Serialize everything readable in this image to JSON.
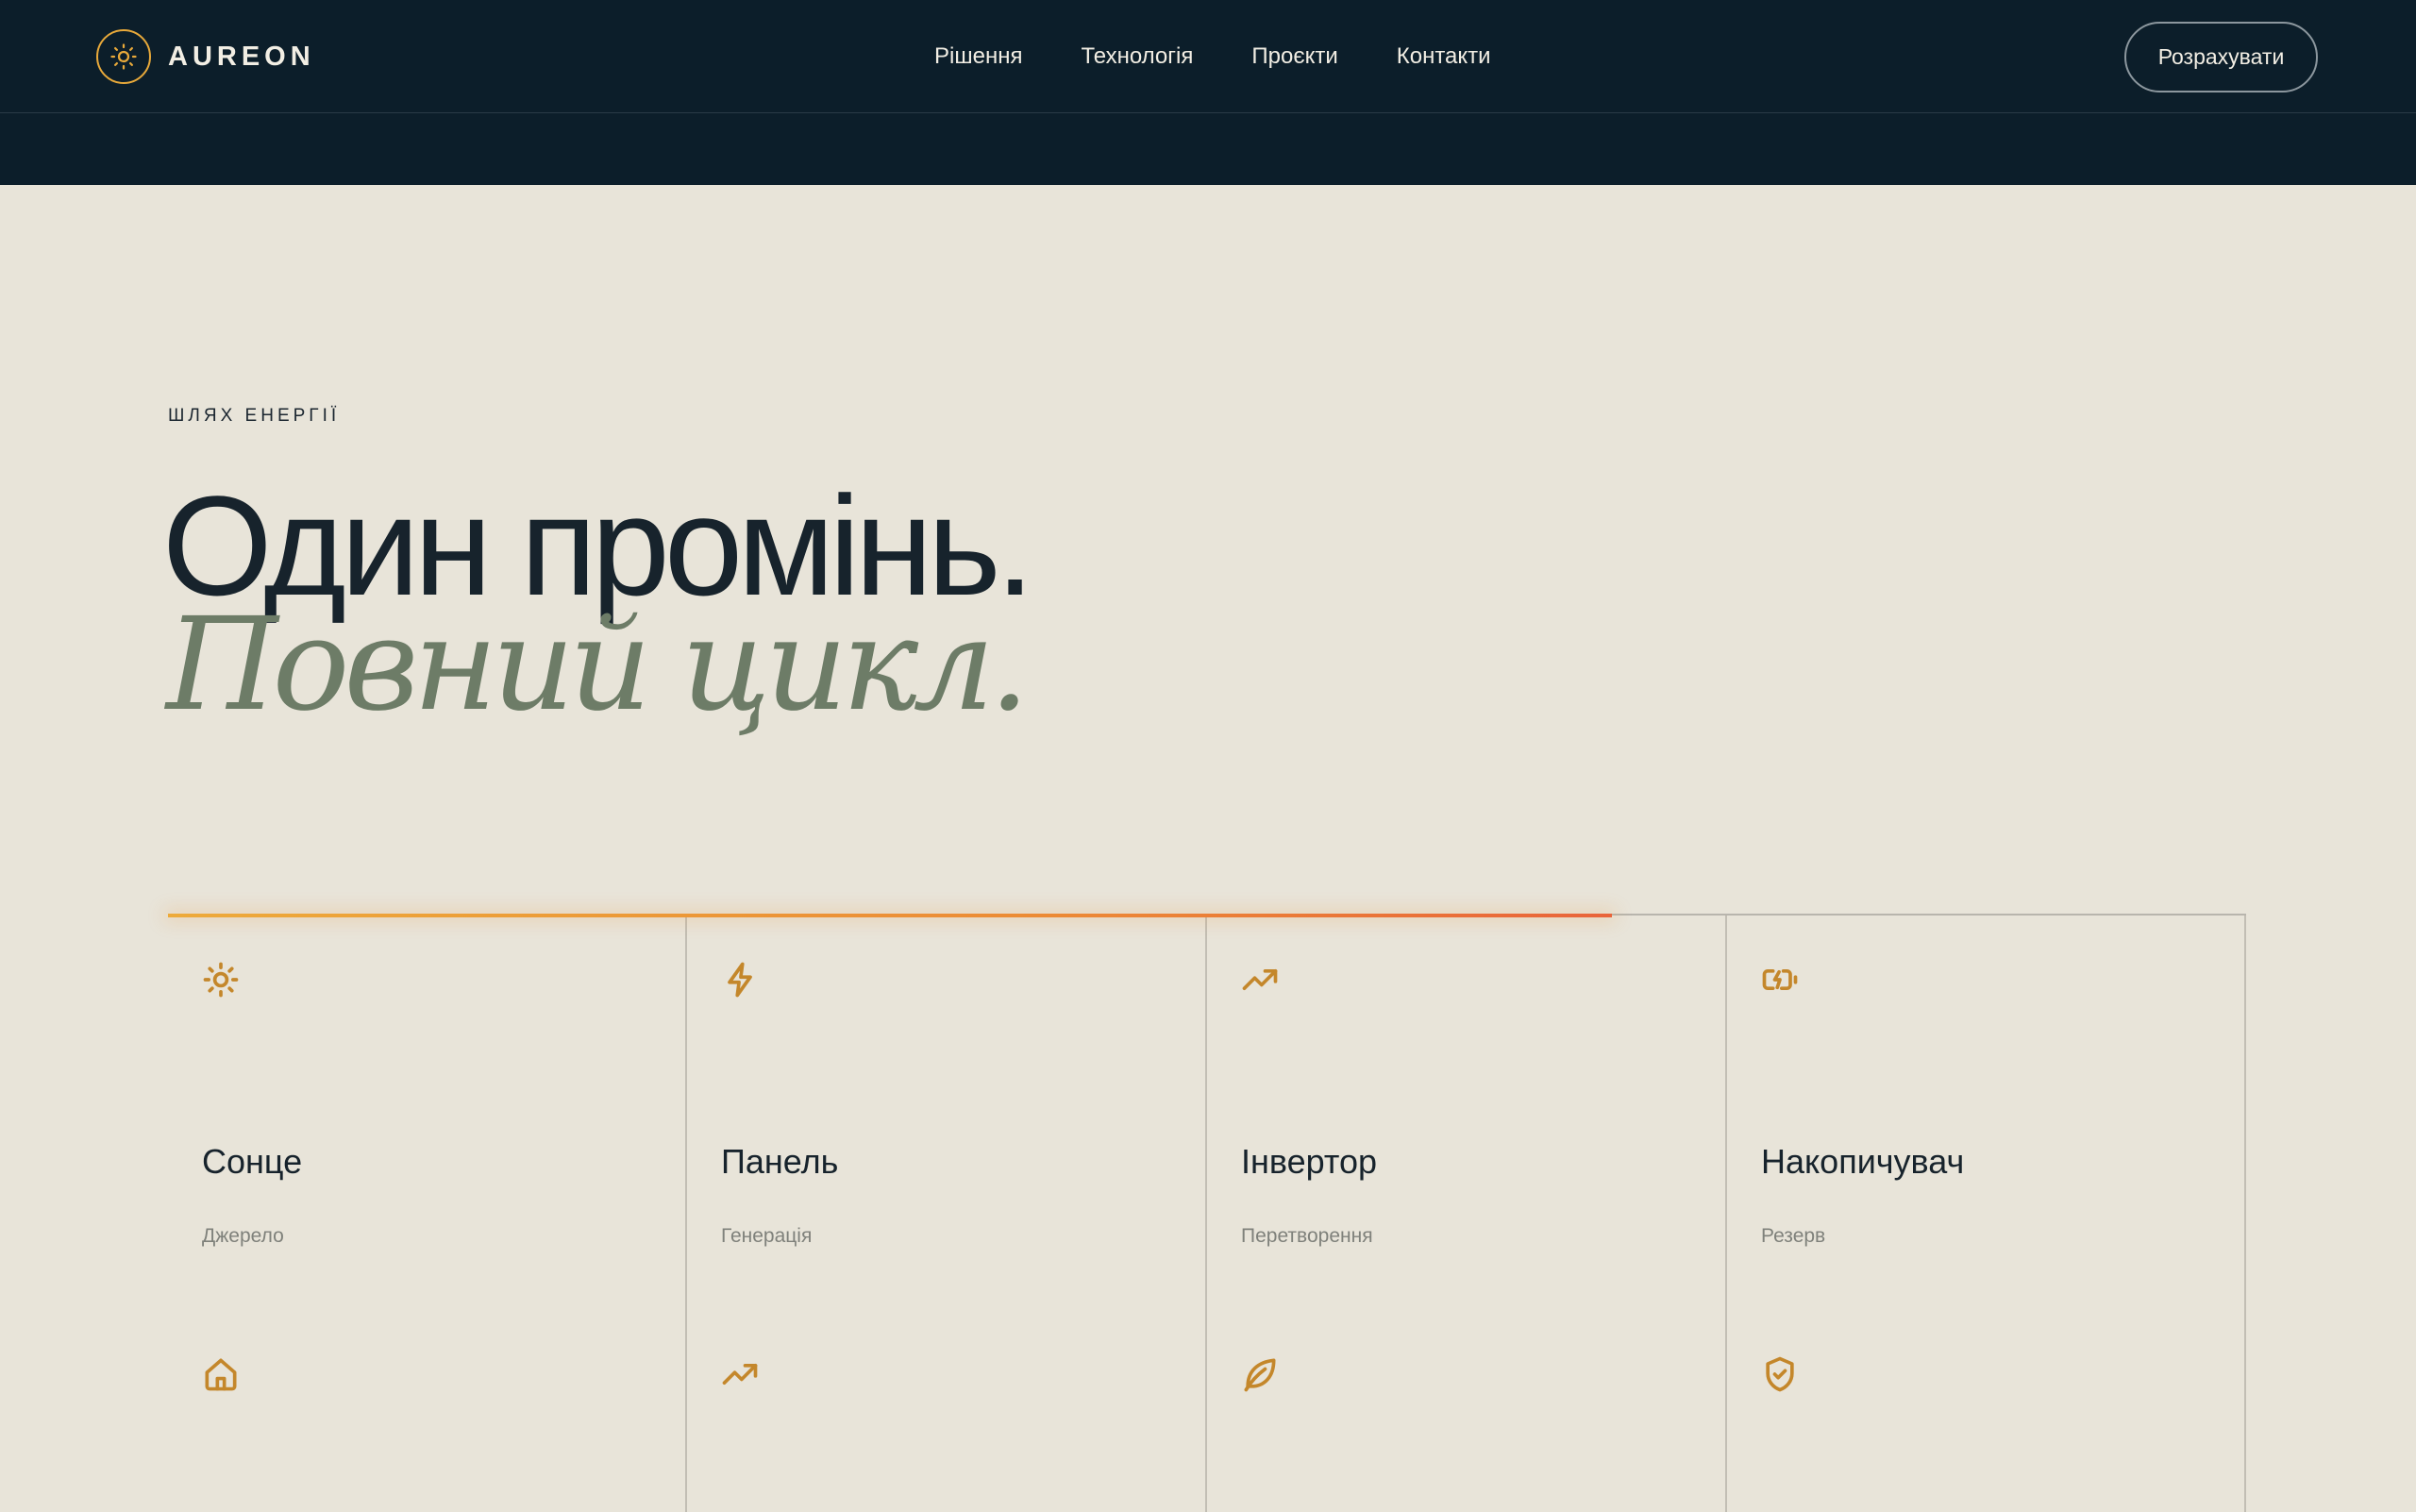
{
  "brand": {
    "name": "AUREON",
    "icon": "sun-icon",
    "accent": "#E8A93A"
  },
  "nav": {
    "items": [
      {
        "label": "Рішення"
      },
      {
        "label": "Технологія"
      },
      {
        "label": "Проєкти"
      },
      {
        "label": "Контакти"
      }
    ],
    "cta_label": "Розрахувати"
  },
  "hero": {
    "eyebrow": "ШЛЯХ ЕНЕРГІЇ",
    "headline": "Один промінь.",
    "headline_italic": "Повний цикл."
  },
  "energy_path": {
    "progress": 0.695,
    "progress_colors": [
      "#EDAA3A",
      "#E9643A"
    ],
    "steps": [
      {
        "icon": "sun-icon",
        "title": "Сонце",
        "subtitle": "Джерело",
        "secondary_icon": "home-icon"
      },
      {
        "icon": "lightning-icon",
        "title": "Панель",
        "subtitle": "Генерація",
        "secondary_icon": "trending-up-icon"
      },
      {
        "icon": "trending-up-icon",
        "title": "Інвертор",
        "subtitle": "Перетворення",
        "secondary_icon": "leaf-icon"
      },
      {
        "icon": "battery-charging-icon",
        "title": "Накопичувач",
        "subtitle": "Резерв",
        "secondary_icon": "shield-check-icon"
      }
    ]
  },
  "colors": {
    "header_bg": "#0C1E2A",
    "page_bg": "#E8E4D9",
    "headline": "#17232C",
    "headline_italic": "#6D7C67",
    "icon": "#C4872B"
  }
}
